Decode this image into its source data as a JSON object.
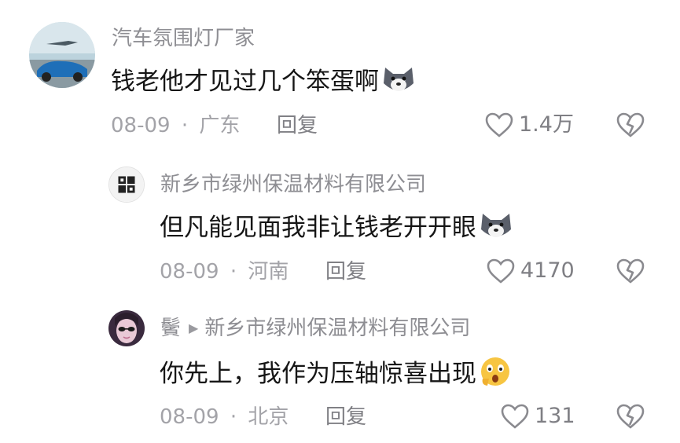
{
  "comments": [
    {
      "username": "汽车氛围灯厂家",
      "text": "钱老他才见过几个笨蛋啊",
      "emoji": "husky-emoji",
      "date": "08-09",
      "location": "广东",
      "reply_label": "回复",
      "like_count": "1.4万"
    },
    {
      "username": "新乡市绿州保温材料有限公司",
      "text": "但凡能见面我非让钱老开开眼",
      "emoji": "husky-emoji",
      "date": "08-09",
      "location": "河南",
      "reply_label": "回复",
      "like_count": "4170"
    },
    {
      "username": "鬢",
      "reply_to": "新乡市绿州保温材料有限公司",
      "text": "你先上，我作为压轴惊喜出现",
      "emoji": "shocked-emoji",
      "date": "08-09",
      "location": "北京",
      "reply_label": "回复",
      "like_count": "131"
    }
  ],
  "separator": "·"
}
